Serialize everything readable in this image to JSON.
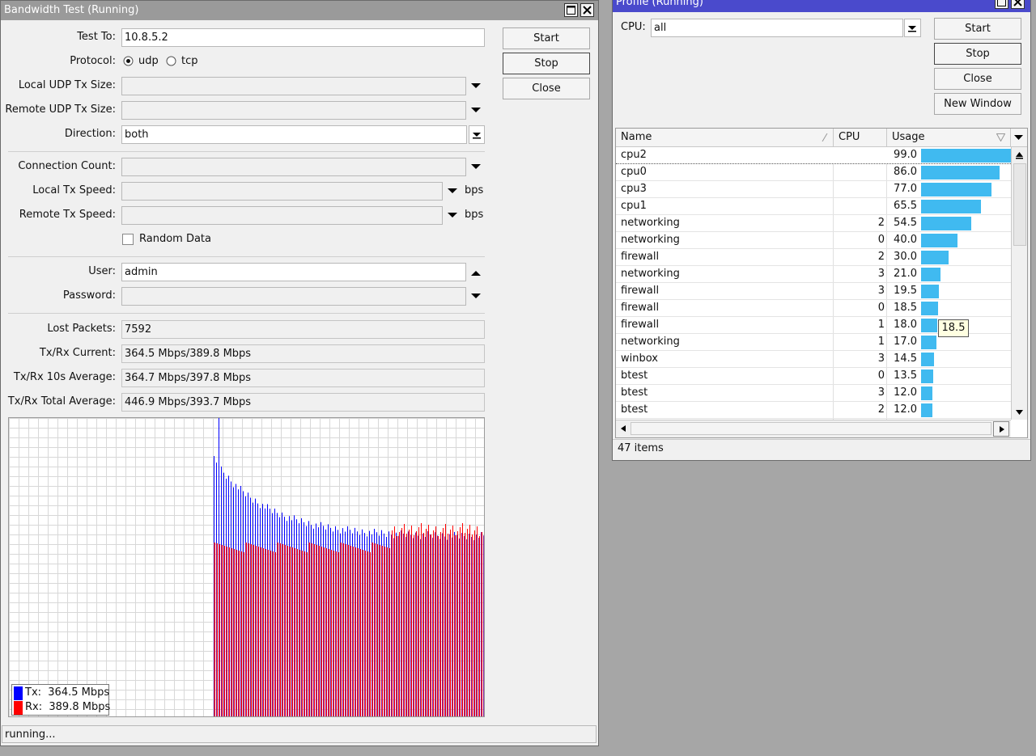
{
  "bandwidth": {
    "title": "Bandwidth Test (Running)",
    "test_to_label": "Test To:",
    "test_to_value": "10.8.5.2",
    "protocol_label": "Protocol:",
    "protocol_options": [
      "udp",
      "tcp"
    ],
    "protocol_selected": "udp",
    "local_udp_label": "Local UDP Tx Size:",
    "remote_udp_label": "Remote UDP Tx Size:",
    "direction_label": "Direction:",
    "direction_value": "both",
    "connection_count_label": "Connection Count:",
    "local_tx_speed_label": "Local Tx Speed:",
    "remote_tx_speed_label": "Remote Tx Speed:",
    "speed_unit": "bps",
    "random_data_label": "Random Data",
    "user_label": "User:",
    "user_value": "admin",
    "password_label": "Password:",
    "lost_packets_label": "Lost Packets:",
    "lost_packets_value": "7592",
    "current_label": "Tx/Rx Current:",
    "current_value": "364.5 Mbps/389.8 Mbps",
    "avg10_label": "Tx/Rx 10s Average:",
    "avg10_value": "364.7 Mbps/397.8 Mbps",
    "total_avg_label": "Tx/Rx Total Average:",
    "total_avg_value": "446.9 Mbps/393.7 Mbps",
    "buttons": {
      "start": "Start",
      "stop": "Stop",
      "close": "Close"
    },
    "legend": {
      "tx_label": "Tx:",
      "tx_value": "364.5 Mbps",
      "rx_label": "Rx:",
      "rx_value": "389.8 Mbps"
    },
    "status": "running...",
    "colors": {
      "tx": "#0000ff",
      "rx": "#ff0000",
      "title_bg": "#9a9a9a"
    }
  },
  "profile": {
    "title": "Profile (Running)",
    "cpu_label": "CPU:",
    "cpu_value": "all",
    "buttons": {
      "start": "Start",
      "stop": "Stop",
      "close": "Close",
      "new_window": "New Window"
    },
    "columns": [
      "Name",
      "CPU",
      "Usage"
    ],
    "rows": [
      {
        "name": "cpu2",
        "cpu": "",
        "usage": "99.0"
      },
      {
        "name": "cpu0",
        "cpu": "",
        "usage": "86.0"
      },
      {
        "name": "cpu3",
        "cpu": "",
        "usage": "77.0"
      },
      {
        "name": "cpu1",
        "cpu": "",
        "usage": "65.5"
      },
      {
        "name": "networking",
        "cpu": "2",
        "usage": "54.5"
      },
      {
        "name": "networking",
        "cpu": "0",
        "usage": "40.0"
      },
      {
        "name": "firewall",
        "cpu": "2",
        "usage": "30.0"
      },
      {
        "name": "networking",
        "cpu": "3",
        "usage": "21.0"
      },
      {
        "name": "firewall",
        "cpu": "3",
        "usage": "19.5"
      },
      {
        "name": "firewall",
        "cpu": "0",
        "usage": "18.5"
      },
      {
        "name": "firewall",
        "cpu": "1",
        "usage": "18.0"
      },
      {
        "name": "networking",
        "cpu": "1",
        "usage": "17.0"
      },
      {
        "name": "winbox",
        "cpu": "3",
        "usage": "14.5"
      },
      {
        "name": "btest",
        "cpu": "0",
        "usage": "13.5"
      },
      {
        "name": "btest",
        "cpu": "3",
        "usage": "12.0"
      },
      {
        "name": "btest",
        "cpu": "2",
        "usage": "12.0"
      }
    ],
    "tooltip": "18.5",
    "item_count": "47 items",
    "colors": {
      "title_bg": "#4a4acc",
      "bar": "#40baf0"
    }
  }
}
